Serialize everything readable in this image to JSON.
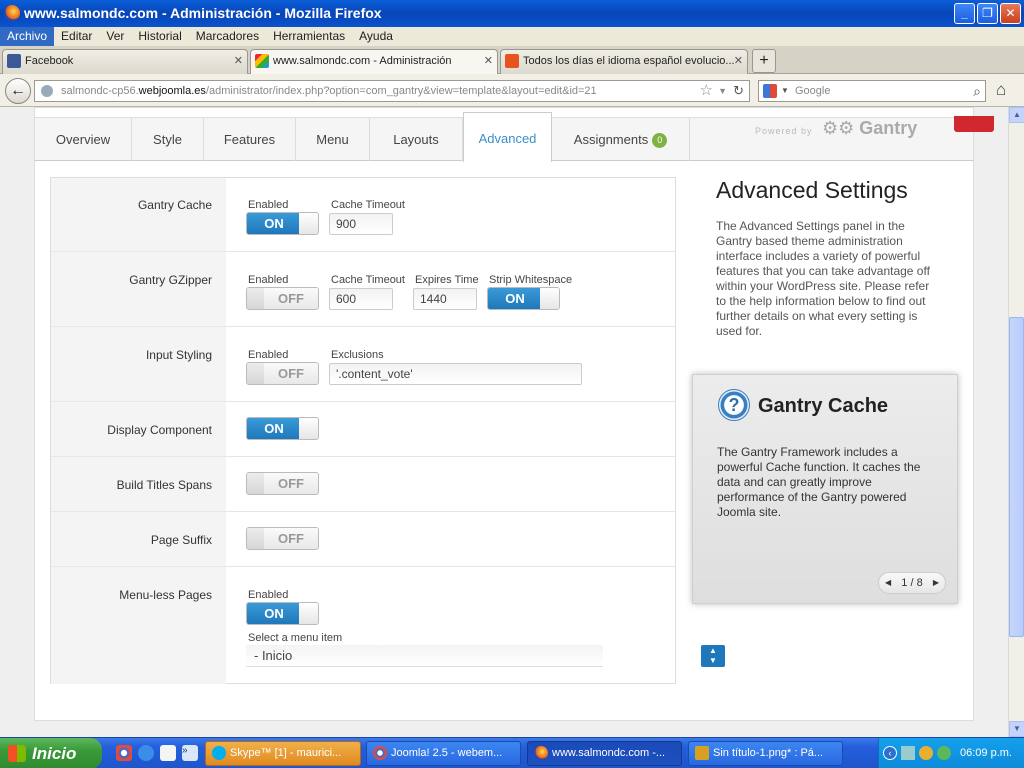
{
  "window": {
    "title": "www.salmondc.com - Administración - Mozilla Firefox"
  },
  "menubar": [
    "Archivo",
    "Editar",
    "Ver",
    "Historial",
    "Marcadores",
    "Herramientas",
    "Ayuda"
  ],
  "browser_tabs": [
    {
      "label": "Facebook"
    },
    {
      "label": "www.salmondc.com - Administración"
    },
    {
      "label": "Todos los días el idioma español evolucio..."
    }
  ],
  "newtab_label": "+",
  "url": {
    "prefix": "salmondc-cp56.",
    "domain": "webjoomla.es",
    "path": "/administrator/index.php?option=com_gantry&view=template&layout=edit&id=21"
  },
  "search": {
    "placeholder": "Google"
  },
  "gantry_tabs": [
    {
      "label": "Overview"
    },
    {
      "label": "Style"
    },
    {
      "label": "Features"
    },
    {
      "label": "Menu"
    },
    {
      "label": "Layouts"
    },
    {
      "label": "Advanced"
    },
    {
      "label": "Assignments",
      "badge": "0"
    }
  ],
  "powered_by": "Powered by",
  "brand": "Gantry",
  "settings": {
    "gantry_cache": {
      "label": "Gantry Cache",
      "enabled_label": "Enabled",
      "enabled": "ON",
      "timeout_label": "Cache Timeout",
      "timeout": "900"
    },
    "gzipper": {
      "label": "Gantry GZipper",
      "enabled_label": "Enabled",
      "enabled": "OFF",
      "timeout_label": "Cache Timeout",
      "timeout": "600",
      "expires_label": "Expires Time",
      "expires": "1440",
      "strip_label": "Strip Whitespace",
      "strip": "ON"
    },
    "input_styling": {
      "label": "Input Styling",
      "enabled_label": "Enabled",
      "enabled": "OFF",
      "exclusions_label": "Exclusions",
      "exclusions": "'.content_vote'"
    },
    "display_component": {
      "label": "Display Component",
      "value": "ON"
    },
    "build_titles": {
      "label": "Build Titles Spans",
      "value": "OFF"
    },
    "page_suffix": {
      "label": "Page Suffix",
      "value": "OFF"
    },
    "menuless": {
      "label": "Menu-less Pages",
      "enabled_label": "Enabled",
      "enabled": "ON",
      "select_label": "Select a menu item",
      "select_value": "- Inicio"
    }
  },
  "sidebar": {
    "title": "Advanced Settings",
    "description": "The Advanced Settings panel in the Gantry based theme administration interface includes a variety of powerful features that you can take advantage off within your WordPress site. Please refer to the help information below to find out further details on what every setting is used for."
  },
  "help": {
    "icon": "?",
    "title": "Gantry Cache",
    "text": "The Gantry Framework includes a powerful Cache function. It caches the data and can greatly improve performance of the Gantry powered Joomla site.",
    "pager": "1 / 8"
  },
  "taskbar": {
    "start": "Inicio",
    "tasks": [
      {
        "label": "Skype™ [1] - maurici..."
      },
      {
        "label": "Joomla! 2.5 - webem..."
      },
      {
        "label": "www.salmondc.com -..."
      },
      {
        "label": "Sin título-1.png* : Pá..."
      }
    ],
    "clock": "06:09 p.m."
  },
  "colors": {
    "accent": "#1f78bb",
    "badge": "#7cb342",
    "flag": "#d0282e"
  }
}
